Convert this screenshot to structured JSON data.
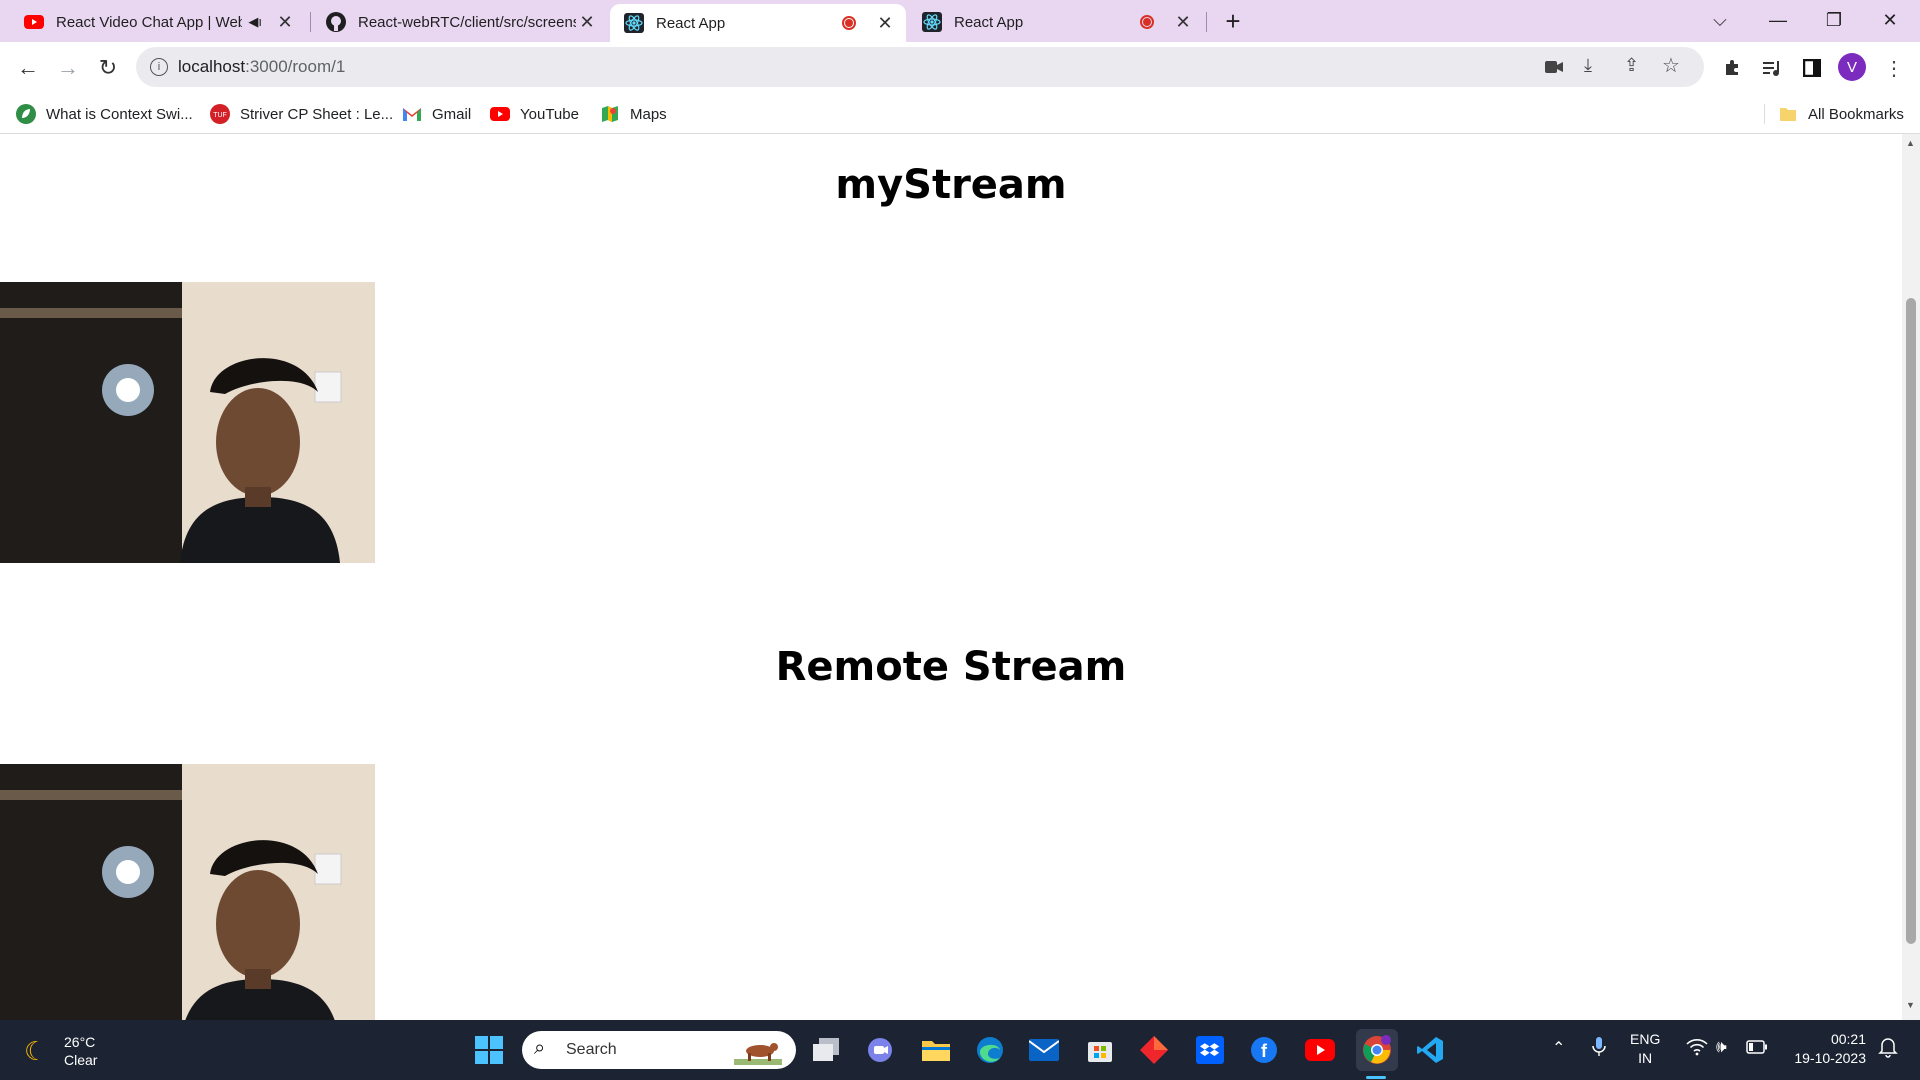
{
  "tabs": [
    {
      "title": "React Video Chat App | Web",
      "favicon": "youtube-icon",
      "audio": true
    },
    {
      "title": "React-webRTC/client/src/screens",
      "favicon": "github-icon"
    },
    {
      "title": "React App",
      "favicon": "react-icon",
      "recording": true,
      "active": true
    },
    {
      "title": "React App",
      "favicon": "react-icon",
      "recording": true
    }
  ],
  "new_tab_symbol": "+",
  "address_bar": {
    "host": "localhost",
    "path": ":3000/room/1"
  },
  "bookmarks": [
    {
      "label": "What is Context Swi...",
      "icon": "leaf-icon"
    },
    {
      "label": "Striver CP Sheet : Le...",
      "icon": "tuf-icon"
    },
    {
      "label": "Gmail",
      "icon": "gmail-icon"
    },
    {
      "label": "YouTube",
      "icon": "youtube-icon"
    },
    {
      "label": "Maps",
      "icon": "maps-icon"
    }
  ],
  "all_bookmarks_label": "All Bookmarks",
  "profile_initial": "V",
  "page": {
    "my_stream_heading": "myStream",
    "remote_stream_heading": "Remote Stream"
  },
  "taskbar": {
    "weather_temp": "26°C",
    "weather_desc": "Clear",
    "search_placeholder": "Search",
    "language": "ENG",
    "region": "IN",
    "time": "00:21",
    "date": "19-10-2023"
  },
  "colors": {
    "tabstrip": "#e9d7f2",
    "taskbar": "#1c2333",
    "recording": "#d93025"
  }
}
